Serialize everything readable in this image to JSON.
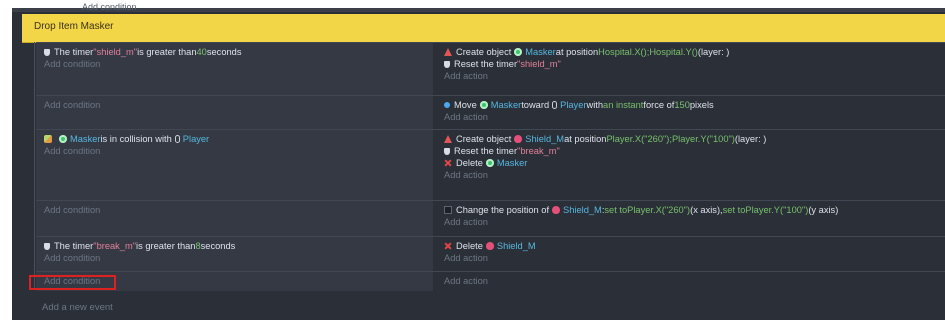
{
  "top_faded_text": "Add condition",
  "group_title": "Drop Item Masker",
  "events": [
    {
      "conditions": [
        {
          "icon": "timer-icon",
          "parts": [
            {
              "t": "The timer "
            },
            {
              "t": "\"shield_m\"",
              "c": "str"
            },
            {
              "t": " is greater than "
            },
            {
              "t": "40",
              "c": "num"
            },
            {
              "t": " seconds"
            }
          ]
        },
        {
          "icon": "",
          "parts": [
            {
              "t": "Add condition",
              "c": "ph"
            }
          ]
        }
      ],
      "actions": [
        {
          "icon": "create-icon",
          "parts": [
            {
              "t": "Create object "
            },
            {
              "t": "",
              "sm": "masker"
            },
            {
              "t": "Masker",
              "c": "obj"
            },
            {
              "t": " at position "
            },
            {
              "t": "Hospital.X();Hospital.Y()",
              "c": "expr"
            },
            {
              "t": " (layer: )"
            }
          ]
        },
        {
          "icon": "timer-icon",
          "parts": [
            {
              "t": "Reset the timer "
            },
            {
              "t": "\"shield_m\"",
              "c": "str"
            }
          ]
        },
        {
          "icon": "",
          "parts": [
            {
              "t": "Add action",
              "c": "ph"
            }
          ]
        }
      ]
    },
    {
      "conditions": [
        {
          "icon": "",
          "parts": [
            {
              "t": "Add condition",
              "c": "ph"
            }
          ]
        }
      ],
      "actions": [
        {
          "icon": "move-icon",
          "parts": [
            {
              "t": "Move "
            },
            {
              "t": "",
              "sm": "masker"
            },
            {
              "t": "Masker",
              "c": "obj"
            },
            {
              "t": " toward "
            },
            {
              "t": "",
              "sm": "player"
            },
            {
              "t": "Player",
              "c": "obj"
            },
            {
              "t": " with "
            },
            {
              "t": "an instant",
              "c": "expr"
            },
            {
              "t": " force of "
            },
            {
              "t": "150",
              "c": "num"
            },
            {
              "t": " pixels"
            }
          ]
        },
        {
          "icon": "",
          "parts": [
            {
              "t": "Add action",
              "c": "ph"
            }
          ]
        }
      ]
    },
    {
      "conditions": [
        {
          "icon": "collision-icon",
          "parts": [
            {
              "t": "",
              "sm": "masker"
            },
            {
              "t": "Masker",
              "c": "obj"
            },
            {
              "t": " is in collision with "
            },
            {
              "t": "",
              "sm": "player"
            },
            {
              "t": "Player",
              "c": "obj"
            }
          ]
        },
        {
          "icon": "",
          "parts": [
            {
              "t": "Add condition",
              "c": "ph"
            }
          ]
        }
      ],
      "actions": [
        {
          "icon": "create-icon",
          "parts": [
            {
              "t": "Create object "
            },
            {
              "t": "",
              "sm": "shield"
            },
            {
              "t": "Shield_M",
              "c": "obj"
            },
            {
              "t": " at position "
            },
            {
              "t": "Player.X(\"260\");Player.Y(\"100\")",
              "c": "expr"
            },
            {
              "t": " (layer: )"
            }
          ]
        },
        {
          "icon": "timer-icon",
          "parts": [
            {
              "t": "Reset the timer "
            },
            {
              "t": "\"break_m\"",
              "c": "str"
            }
          ]
        },
        {
          "icon": "delete-icon",
          "parts": [
            {
              "t": "Delete "
            },
            {
              "t": "",
              "sm": "masker"
            },
            {
              "t": "Masker",
              "c": "obj"
            }
          ]
        },
        {
          "icon": "",
          "parts": [
            {
              "t": "Add action",
              "c": "ph"
            }
          ]
        }
      ]
    },
    {
      "conditions": [
        {
          "icon": "",
          "parts": [
            {
              "t": "Add condition",
              "c": "ph"
            }
          ]
        }
      ],
      "actions": [
        {
          "icon": "position-icon",
          "parts": [
            {
              "t": "Change the position of "
            },
            {
              "t": "",
              "sm": "shield"
            },
            {
              "t": "Shield_M",
              "c": "obj"
            },
            {
              "t": ": "
            },
            {
              "t": "set to ",
              "c": "expr"
            },
            {
              "t": "Player.X(\"260\")",
              "c": "expr"
            },
            {
              "t": " (x axis), "
            },
            {
              "t": "set to ",
              "c": "expr"
            },
            {
              "t": "Player.Y(\"100\")",
              "c": "expr"
            },
            {
              "t": " (y axis)"
            }
          ]
        },
        {
          "icon": "",
          "parts": [
            {
              "t": "Add action",
              "c": "ph"
            }
          ]
        }
      ]
    },
    {
      "conditions": [
        {
          "icon": "timer-icon",
          "parts": [
            {
              "t": "The timer "
            },
            {
              "t": "\"break_m\"",
              "c": "str"
            },
            {
              "t": " is greater than "
            },
            {
              "t": "8",
              "c": "num"
            },
            {
              "t": " seconds"
            }
          ]
        },
        {
          "icon": "",
          "parts": [
            {
              "t": "Add condition",
              "c": "ph"
            }
          ]
        }
      ],
      "actions": [
        {
          "icon": "delete-icon",
          "parts": [
            {
              "t": "Delete "
            },
            {
              "t": "",
              "sm": "shield"
            },
            {
              "t": "Shield_M",
              "c": "obj"
            }
          ]
        },
        {
          "icon": "",
          "parts": [
            {
              "t": "Add action",
              "c": "ph"
            }
          ]
        }
      ]
    },
    {
      "conditions": [
        {
          "icon": "",
          "parts": [
            {
              "t": "Add condition",
              "c": "ph"
            }
          ]
        }
      ],
      "actions": [
        {
          "icon": "",
          "parts": [
            {
              "t": "Add action",
              "c": "ph"
            }
          ]
        }
      ]
    }
  ],
  "footer_label": "Add a new event"
}
